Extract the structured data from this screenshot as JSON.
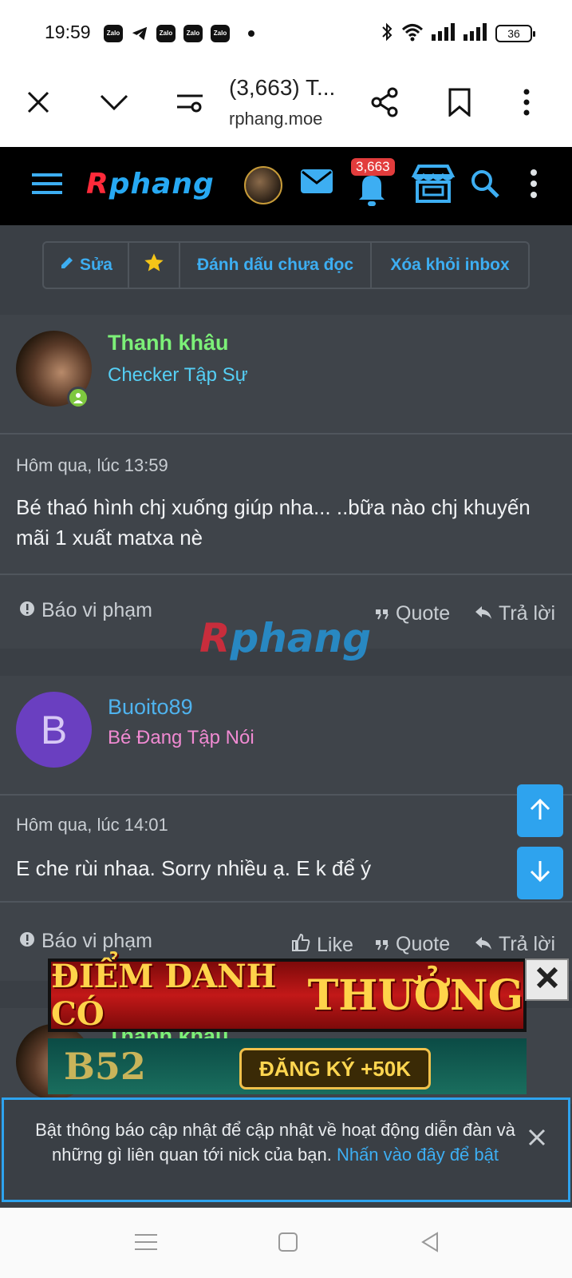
{
  "status_bar": {
    "time": "19:59",
    "apps": [
      "Zalo",
      "Telegram",
      "Zalo",
      "Zalo",
      "Zalo"
    ],
    "battery": "36",
    "icons": [
      "bluetooth-icon",
      "wifi-icon",
      "signal-icon",
      "signal-icon",
      "battery-icon"
    ]
  },
  "browser": {
    "title": "(3,663) T...",
    "url": "rphang.moe"
  },
  "site_header": {
    "logo": {
      "r": "R",
      "rest": "phang"
    },
    "notification_count": "3,663"
  },
  "toolbar": {
    "edit_label": "Sửa",
    "mark_unread_label": "Đánh dấu chưa đọc",
    "remove_inbox_label": "Xóa khỏi inbox"
  },
  "posts": [
    {
      "username": "Thanh khâu",
      "user_title": "Checker Tập Sự",
      "time": "Hôm qua, lúc 13:59",
      "body": "Bé thaó hình chj xuống giúp nha... ..bữa nào chj khuyến mãi 1 xuất matxa nè",
      "report_label": "Báo vi phạm",
      "quote_label": "Quote",
      "reply_label": "Trả lời"
    },
    {
      "username": "Buoito89",
      "avatar_letter": "B",
      "user_title": "Bé Đang Tập Nói",
      "time": "Hôm qua, lúc 14:01",
      "body": "E che rùi nhaa. Sorry nhiều ạ. E k để ý",
      "report_label": "Báo vi phạm",
      "like_label": "Like",
      "quote_label": "Quote",
      "reply_label": "Trả lời"
    },
    {
      "username": "Thanh khâu"
    }
  ],
  "watermark": {
    "r": "R",
    "rest": "phang"
  },
  "ads": {
    "banner1_a": "ĐIỂM DANH CÓ ",
    "banner1_b": "THƯỞNG",
    "banner2_brand": "B52",
    "banner2_cta": "ĐĂNG KÝ +50K"
  },
  "notify": {
    "text": "Bật thông báo cập nhật để cập nhật về hoạt động diễn đàn và những gì liên quan tới nick của bạn. ",
    "link": "Nhấn vào đây để bật"
  },
  "colors": {
    "accent": "#2ea3ee",
    "online": "#7ec83f",
    "username_green": "#7cf078",
    "title_cyan": "#55cff5",
    "username_blue": "#4fb3ee",
    "title_pink": "#f08ad2",
    "avatar_purple": "#6a3fc0"
  }
}
